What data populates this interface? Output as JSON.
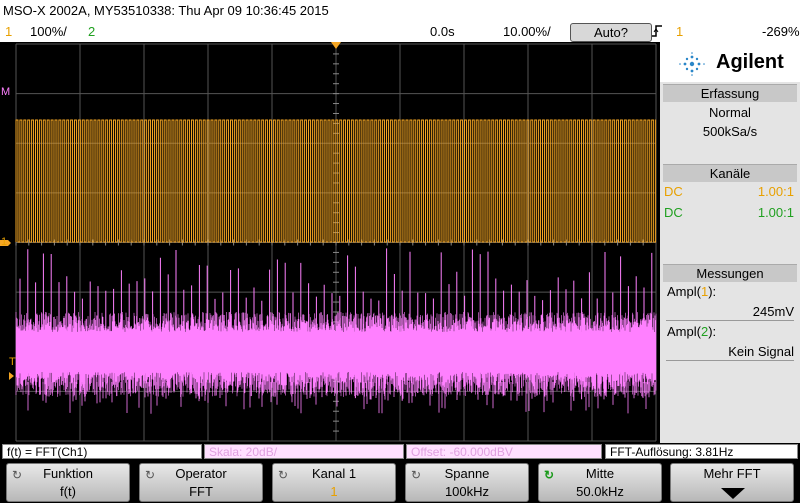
{
  "header": {
    "title": "MSO-X 2002A, MY53510338: Thu Apr 09 10:36:45 2015"
  },
  "status": {
    "ch1_num": "1",
    "ch1_scale": "100%/",
    "ch2_num": "2",
    "time_pos": "0.0s",
    "time_scale": "10.00%/",
    "mode_btn": "Auto?",
    "trig_icon": "rising-edge-icon",
    "trig_ch": "1",
    "trig_level": "-269%"
  },
  "sidebar": {
    "brand": "Agilent",
    "acq_title": "Erfassung",
    "acq_mode": "Normal",
    "acq_rate": "500kSa/s",
    "ch_title": "Kanäle",
    "ch1_coupling": "DC",
    "ch1_ratio": "1.00:1",
    "ch2_coupling": "DC",
    "ch2_ratio": "1.00:1",
    "meas_title": "Messungen",
    "m1_label": "Ampl(",
    "m1_ch": "1",
    "m1_close": "):",
    "m1_value": "245mV",
    "m2_label": "Ampl(",
    "m2_ch": "2",
    "m2_close": "):",
    "m2_value": "Kein Signal"
  },
  "plot_markers": {
    "m_label": "M",
    "ch1_label": "1",
    "trig_label": "T"
  },
  "infobar": {
    "func": "f(t) = FFT(Ch1)",
    "scale": "Skala: 20dB/",
    "offset": "Offset: -60.000dBV",
    "resolution": "FFT-Auflösung: 3.81Hz"
  },
  "softkeys": [
    {
      "label": "Funktion",
      "value": "f(t)"
    },
    {
      "label": "Operator",
      "value": "FFT"
    },
    {
      "label": "Kanal 1",
      "value": "1"
    },
    {
      "label": "Spanne",
      "value": "100kHz"
    },
    {
      "label": "Mitte",
      "value": "50.0kHz"
    },
    {
      "label": "Mehr FFT",
      "value": ""
    }
  ],
  "colors": {
    "ch1": "#f5a623",
    "ch2": "#2db82d",
    "math": "#ff80ff",
    "grid": "#555555"
  }
}
